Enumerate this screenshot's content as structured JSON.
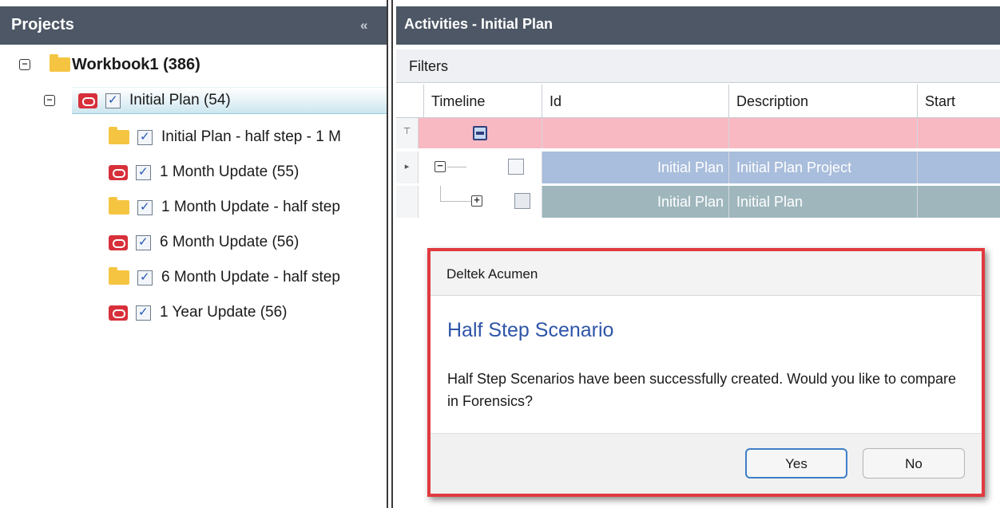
{
  "projects_panel": {
    "title": "Projects",
    "collapse_icon": "«",
    "root": {
      "label": "Workbook1 (386)",
      "toggle": "−",
      "icon": "folder-icon"
    },
    "items": [
      {
        "label": "Initial  Plan (54)",
        "toggle": "−",
        "icon": "project-icon",
        "checked": true,
        "selected": true
      },
      {
        "label": "Initial  Plan - half step - 1 M",
        "icon": "folder-icon",
        "checked": true
      },
      {
        "label": "1 Month Update (55)",
        "icon": "project-icon",
        "checked": true
      },
      {
        "label": "1 Month Update - half step",
        "icon": "folder-icon",
        "checked": true
      },
      {
        "label": "6 Month Update (56)",
        "icon": "project-icon",
        "checked": true
      },
      {
        "label": "6 Month Update - half step",
        "icon": "folder-icon",
        "checked": true
      },
      {
        "label": "1 Year Update (56)",
        "icon": "project-icon",
        "checked": true
      }
    ]
  },
  "activities_panel": {
    "title": "Activities - Initial  Plan",
    "filters_label": "Filters",
    "columns": [
      "Timeline",
      "Id",
      "Description",
      "Start"
    ],
    "filter_row_indicator": "⊤",
    "rows": [
      {
        "indicator": "▸",
        "toggle": "−",
        "id": "Initial  Plan",
        "description": "Initial  Plan Project",
        "start": ""
      },
      {
        "indicator": "",
        "toggle": "+",
        "id": "Initial  Plan",
        "description": "Initial  Plan",
        "start": ""
      }
    ]
  },
  "dialog": {
    "window_title": "Deltek Acumen",
    "heading": "Half Step Scenario",
    "message": "Half Step Scenarios have been successfully created. Would you like to compare in Forensics?",
    "yes_label": "Yes",
    "no_label": "No"
  },
  "colors": {
    "header_bar": "#4d5765",
    "filter_row": "#f8b9c3",
    "row_project": "#a9bddc",
    "row_child": "#9fb6bd",
    "dialog_highlight": "#e03a3f",
    "dialog_heading": "#2e55a8",
    "project_icon": "#d7303a",
    "folder_icon": "#f5c542"
  }
}
